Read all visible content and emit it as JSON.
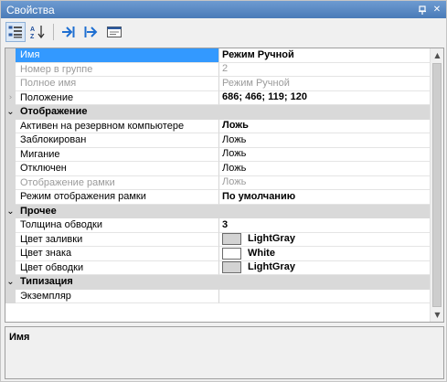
{
  "window": {
    "title": "Свойства"
  },
  "titlebar_buttons": {
    "pin": "🞘",
    "close": "✕"
  },
  "toolbar": {
    "buttons": [
      {
        "name": "categorized",
        "active": true
      },
      {
        "name": "alphabetical",
        "active": false
      },
      {
        "name": "pin-arrow",
        "active": false
      },
      {
        "name": "go-arrow",
        "active": false
      },
      {
        "name": "property-pages",
        "active": false
      }
    ],
    "alpha_sort_text": "AZ"
  },
  "grid": {
    "rows": [
      {
        "type": "prop",
        "name": "Имя",
        "value": "Режим Ручной",
        "selected": true,
        "disabled": false,
        "bold": true
      },
      {
        "type": "prop",
        "name": "Номер в группе",
        "value": "2",
        "selected": false,
        "disabled": true,
        "bold": false
      },
      {
        "type": "prop",
        "name": "Полное имя",
        "value": "Режим Ручной",
        "selected": false,
        "disabled": true,
        "bold": false
      },
      {
        "type": "prop",
        "name": "Положение",
        "value": "686; 466; 119; 120",
        "selected": false,
        "disabled": false,
        "bold": true,
        "expander": "›"
      },
      {
        "type": "category",
        "name": "Отображение",
        "expander": "⌄"
      },
      {
        "type": "prop",
        "name": "Активен на резервном компьютере",
        "value": "Ложь",
        "selected": false,
        "disabled": false,
        "bold": true
      },
      {
        "type": "prop",
        "name": "Заблокирован",
        "value": "Ложь",
        "selected": false,
        "disabled": false,
        "bold": false
      },
      {
        "type": "prop",
        "name": "Мигание",
        "value": "Ложь",
        "selected": false,
        "disabled": false,
        "bold": false
      },
      {
        "type": "prop",
        "name": "Отключен",
        "value": "Ложь",
        "selected": false,
        "disabled": false,
        "bold": false
      },
      {
        "type": "prop",
        "name": "Отображение рамки",
        "value": "Ложь",
        "selected": false,
        "disabled": true,
        "bold": false
      },
      {
        "type": "prop",
        "name": "Режим отображения рамки",
        "value": "По умолчанию",
        "selected": false,
        "disabled": false,
        "bold": true
      },
      {
        "type": "category",
        "name": "Прочее",
        "expander": "⌄"
      },
      {
        "type": "prop",
        "name": "Толщина обводки",
        "value": "3",
        "selected": false,
        "disabled": false,
        "bold": true
      },
      {
        "type": "color",
        "name": "Цвет заливки",
        "value": "LightGray",
        "swatch": "#d3d3d3"
      },
      {
        "type": "color",
        "name": "Цвет знака",
        "value": "White",
        "swatch": "#ffffff"
      },
      {
        "type": "color",
        "name": "Цвет обводки",
        "value": "LightGray",
        "swatch": "#d3d3d3"
      },
      {
        "type": "category",
        "name": "Типизация",
        "expander": "⌄"
      },
      {
        "type": "prop",
        "name": "Экземпляр",
        "value": "",
        "selected": false,
        "disabled": false,
        "bold": false
      }
    ]
  },
  "scrollbar": {
    "up": "▲",
    "down": "▼"
  },
  "description": {
    "title": "Имя",
    "text": ""
  },
  "colors": {
    "title_bar": "#4a7bb8",
    "selection": "#3399ff",
    "category_bg": "#d9d9d9",
    "disabled_text": "#9b9b9b"
  }
}
